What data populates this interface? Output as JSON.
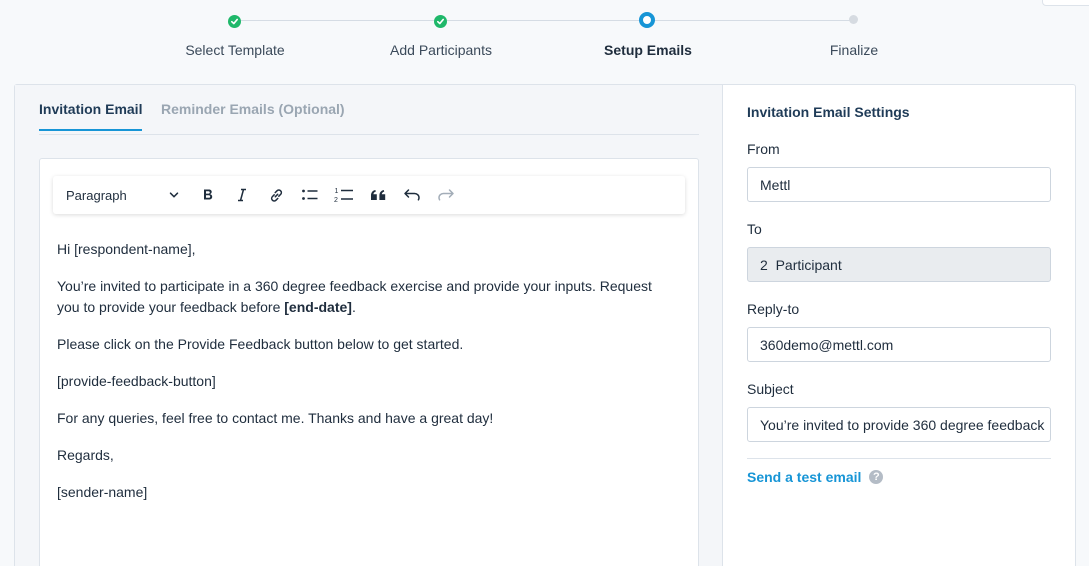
{
  "stepper": {
    "steps": [
      {
        "label": "Select Template",
        "state": "done"
      },
      {
        "label": "Add Participants",
        "state": "done"
      },
      {
        "label": "Setup Emails",
        "state": "active"
      },
      {
        "label": "Finalize",
        "state": "pending"
      }
    ]
  },
  "tabs": {
    "invitation": "Invitation Email",
    "reminder": "Reminder Emails (Optional)"
  },
  "toolbar": {
    "format_value": "Paragraph",
    "icons": [
      "chevron-down-icon",
      "bold-icon",
      "italic-icon",
      "link-icon",
      "bulleted-list-icon",
      "numbered-list-icon",
      "blockquote-icon",
      "undo-icon",
      "redo-icon"
    ]
  },
  "email_body": {
    "greeting": "Hi [respondent-name],",
    "para1_text": "You’re invited to participate in a 360 degree feedback exercise and provide your inputs. Request you to provide your feedback before ",
    "para1_bold": "[end-date]",
    "para1_end": ".",
    "para2": "Please click on the Provide Feedback button below to get started.",
    "button_placeholder": "[provide-feedback-button]",
    "para3": "For any queries, feel free to contact me. Thanks and have a great day!",
    "regards": "Regards,",
    "sender": "[sender-name]"
  },
  "settings": {
    "title": "Invitation Email Settings",
    "from_label": "From",
    "from_value": "Mettl",
    "to_label": "To",
    "to_value": "2  Participant",
    "reply_label": "Reply-to",
    "reply_value": "360demo@mettl.com",
    "subject_label": "Subject",
    "subject_value": "You’re invited to provide 360 degree feedback",
    "test_link": "Send a test email",
    "help_symbol": "?"
  },
  "colors": {
    "accent": "#1795d6",
    "done": "#1fb86a",
    "pending": "#d6dbe1"
  }
}
